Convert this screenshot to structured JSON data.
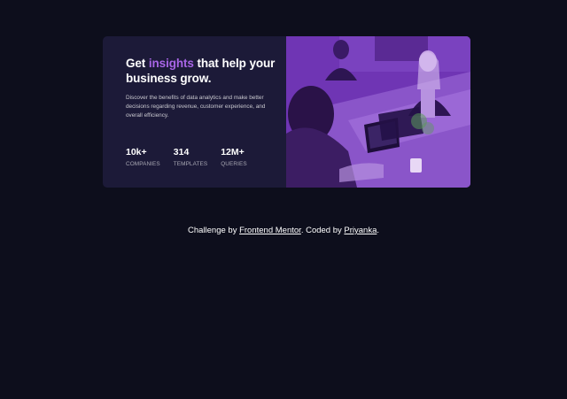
{
  "card": {
    "headline_pre": "Get ",
    "headline_accent": "insights",
    "headline_post": " that help your business grow.",
    "description": "Discover the benefits of data analytics and make better decisions regarding revenue, customer experience, and overall efficiency.",
    "stats": [
      {
        "value": "10k+",
        "label": "COMPANIES"
      },
      {
        "value": "314",
        "label": "TEMPLATES"
      },
      {
        "value": "12M+",
        "label": "QUERIES"
      }
    ],
    "image_alt": "Women working on laptops"
  },
  "footer": {
    "prefix": "Challenge by ",
    "link1": "Frontend Mentor",
    "middle": ". Coded by ",
    "link2": "Priyanka",
    "suffix": "."
  },
  "colors": {
    "background": "#0d0e1c",
    "card": "#1c1a38",
    "accent": "#a865e6",
    "image_overlay": "#6f35b4"
  }
}
